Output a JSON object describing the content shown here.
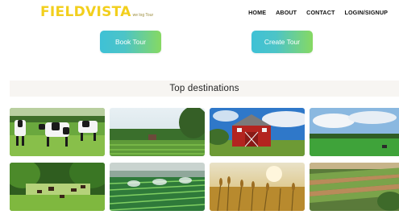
{
  "header": {
    "logo_text": "FIELDVISTA",
    "tagline": "we log Tour",
    "nav": [
      {
        "label": "HOME"
      },
      {
        "label": "ABOUT"
      },
      {
        "label": "CONTACT"
      },
      {
        "label": "LOGIN/SIGNUP"
      }
    ]
  },
  "actions": {
    "book_label": "Book Tour",
    "create_label": "Create Tour"
  },
  "destinations": {
    "title": "Top destinations",
    "images": [
      {
        "subject": "cows-in-pasture"
      },
      {
        "subject": "green-fields-with-barn"
      },
      {
        "subject": "red-barn"
      },
      {
        "subject": "open-meadow-with-tractor"
      },
      {
        "subject": "cattle-under-trees"
      },
      {
        "subject": "crop-rows-irrigation"
      },
      {
        "subject": "wheat-at-sunset"
      },
      {
        "subject": "terraced-farmland"
      }
    ]
  },
  "colors": {
    "logo": "#f2cf1d",
    "button_gradient_start": "#3ec1d6",
    "button_gradient_end": "#86d962"
  }
}
